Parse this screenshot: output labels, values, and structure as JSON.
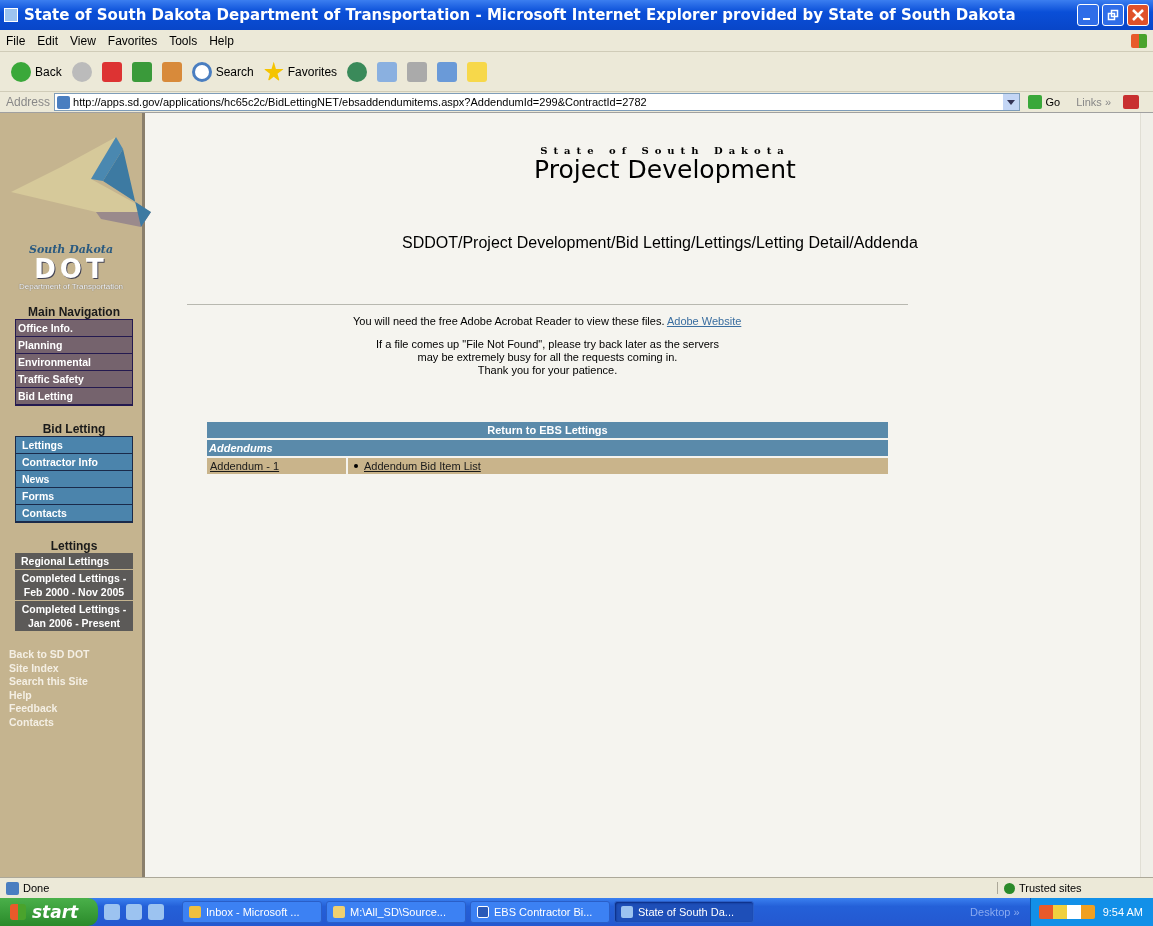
{
  "window": {
    "title": "State of South Dakota Department of Transportation - Microsoft Internet Explorer provided by State of South Dakota"
  },
  "menu": [
    "File",
    "Edit",
    "View",
    "Favorites",
    "Tools",
    "Help"
  ],
  "toolbar": [
    {
      "kind": "back",
      "label": "Back"
    },
    {
      "kind": "forward"
    },
    {
      "kind": "stop"
    },
    {
      "kind": "refresh"
    },
    {
      "kind": "home"
    },
    {
      "kind": "search",
      "label": "Search"
    },
    {
      "kind": "favorites",
      "label": "Favorites"
    },
    {
      "kind": "history"
    },
    {
      "kind": "mail"
    },
    {
      "kind": "print"
    },
    {
      "kind": "edit"
    },
    {
      "kind": "note"
    }
  ],
  "address": {
    "label": "Address",
    "value": "http://apps.sd.gov/applications/hc65c2c/BidLettingNET/ebsaddendumitems.aspx?AddendumId=299&ContractId=2782",
    "go": "Go",
    "links": "Links »"
  },
  "logo": {
    "script": "South Dakota",
    "mark": "DOT",
    "caption": "Department of Transportation"
  },
  "nav_groups": [
    {
      "title": "Main Navigation",
      "kind": "main",
      "items": [
        "Office Info.",
        "Planning",
        "Environmental",
        "Traffic Safety",
        "Bid Letting"
      ]
    },
    {
      "title": "Bid Letting",
      "kind": "section",
      "items": [
        "Lettings",
        "Contractor Info",
        "News",
        "Forms",
        "Contacts"
      ]
    },
    {
      "title": "Lettings",
      "kind": "lettings",
      "items": [
        "Regional Lettings",
        "Completed Lettings - Feb 2000 - Nov 2005",
        "Completed Lettings - Jan 2006 - Present"
      ]
    }
  ],
  "footer_links": [
    "Back to SD DOT",
    "Site Index",
    "Search this Site",
    "Help",
    "Feedback",
    "Contacts"
  ],
  "header": {
    "overline": "State of South Dakota",
    "title": "Project Development"
  },
  "breadcrumb": "SDDOT/Project Development/Bid Letting/Lettings/Letting Detail/Addenda",
  "notice": {
    "text": "You will need the free Adobe Acrobat Reader to view these files.",
    "link": "Adobe Website"
  },
  "message": [
    "If a file comes up \"File Not Found\", please try back later as the servers",
    "may be extremely busy for all the requests coming in.",
    "Thank you for your patience."
  ],
  "table": {
    "return_link": "Return to EBS Lettings",
    "section": "Addendums",
    "rows": [
      {
        "name": "Addendum - 1",
        "items": [
          "Addendum Bid Item List"
        ]
      }
    ]
  },
  "status_bar": {
    "text": "Done",
    "zone": "Trusted sites"
  },
  "taskbar": {
    "start": "start",
    "tasks": [
      {
        "label": "Inbox - Microsoft ...",
        "kind": "mail",
        "selected": false
      },
      {
        "label": "M:\\All_SD\\Source...",
        "kind": "folder",
        "selected": false
      },
      {
        "label": "EBS Contractor Bi...",
        "kind": "doc",
        "selected": false
      },
      {
        "label": "State of South Da...",
        "kind": "browser",
        "selected": true
      }
    ],
    "desktop": "Desktop »",
    "clock": "9:54 AM"
  }
}
